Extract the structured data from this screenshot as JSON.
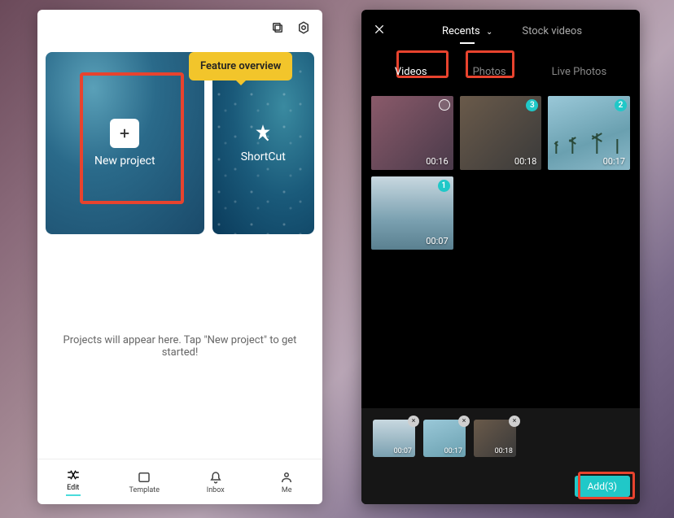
{
  "left": {
    "feature_badge": "Feature overview",
    "new_project_label": "New project",
    "shortcut_label": "ShortCut",
    "empty_text": "Projects will appear here. Tap \"New project\" to get started!",
    "nav": {
      "edit": "Edit",
      "template": "Template",
      "inbox": "Inbox",
      "me": "Me"
    }
  },
  "right": {
    "header": {
      "recents": "Recents",
      "stock": "Stock videos"
    },
    "media_tabs": {
      "videos": "Videos",
      "photos": "Photos",
      "live": "Live Photos"
    },
    "media": [
      {
        "duration": "00:16",
        "selected": false
      },
      {
        "duration": "00:18",
        "selected_num": 3
      },
      {
        "duration": "00:17",
        "selected_num": 2
      },
      {
        "duration": "00:07",
        "selected_num": 1
      }
    ],
    "selected": [
      {
        "duration": "00:07"
      },
      {
        "duration": "00:17"
      },
      {
        "duration": "00:18"
      }
    ],
    "add_label": "Add(3)"
  }
}
